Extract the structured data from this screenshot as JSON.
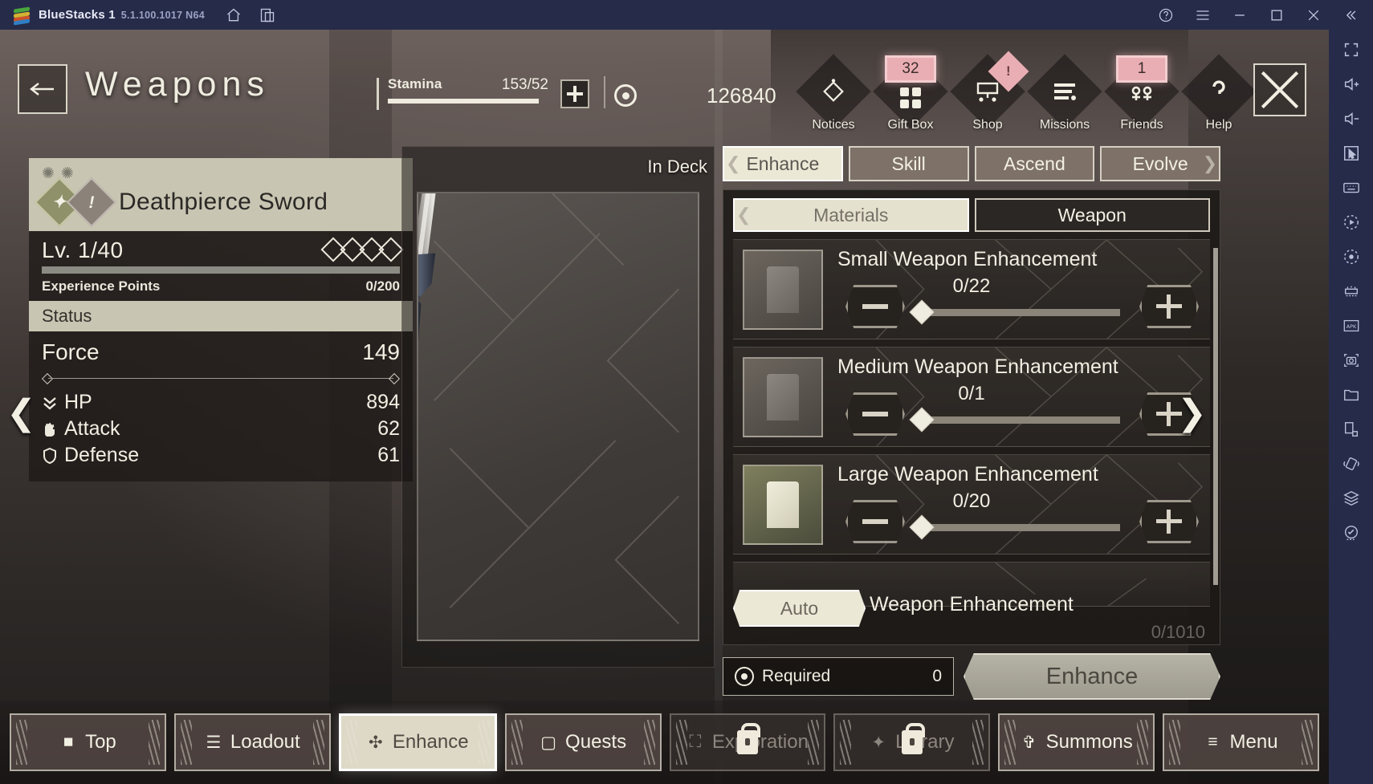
{
  "titlebar": {
    "app_name": "BlueStacks 1",
    "version": "5.1.100.1017 N64",
    "icons_left": [
      "home-icon",
      "multi-instance-icon"
    ],
    "icons_right": [
      "help-icon",
      "hamburger-menu-icon",
      "minimize-icon",
      "maximize-icon",
      "close-icon",
      "collapse-icon"
    ]
  },
  "game": {
    "header": {
      "back_label": "back-arrow",
      "title": "Weapons",
      "stamina_label": "Stamina",
      "stamina_value": "153/52",
      "stamina_plus": "+",
      "currency_value": "126840",
      "menu": [
        {
          "label": "Notices",
          "icon": "diamond-notice-icon",
          "badge": ""
        },
        {
          "label": "Gift Box",
          "icon": "gift-grid-icon",
          "badge": "32"
        },
        {
          "label": "Shop",
          "icon": "shop-cart-icon",
          "badge": "",
          "corner_badge": "!"
        },
        {
          "label": "Missions",
          "icon": "missions-list-icon",
          "badge": ""
        },
        {
          "label": "Friends",
          "icon": "friends-icon",
          "badge": "1"
        },
        {
          "label": "Help",
          "icon": "question-mark-icon",
          "badge": ""
        }
      ],
      "close_label": "close-screen"
    },
    "weapon_card": {
      "rarity_stars": [
        "star",
        "star"
      ],
      "icon_element": "element-diamond-icon",
      "icon_alert": "alert-diamond-icon",
      "name": "Deathpierce Sword",
      "level_label": "Lv. 1/40",
      "limit_break_slots": 4,
      "xp_label": "Experience Points",
      "xp_value": "0/200",
      "status_header": "Status",
      "force_label": "Force",
      "force_value": "149",
      "stats": [
        {
          "icon": "hp-chevrons-icon",
          "label": "HP",
          "value": "894"
        },
        {
          "icon": "attack-fist-icon",
          "label": "Attack",
          "value": "62"
        },
        {
          "icon": "defense-shield-icon",
          "label": "Defense",
          "value": "61"
        }
      ]
    },
    "weapon_preview": {
      "in_deck_label": "In Deck",
      "art": "sword-illustration"
    },
    "enhance": {
      "top_tabs": [
        {
          "label": "Enhance",
          "active": true
        },
        {
          "label": "Skill",
          "active": false
        },
        {
          "label": "Ascend",
          "active": false
        },
        {
          "label": "Evolve",
          "active": false
        }
      ],
      "sub_tabs": [
        {
          "label": "Materials",
          "style": "light"
        },
        {
          "label": "Weapon",
          "style": "dark"
        }
      ],
      "rows": [
        {
          "title": "Small Weapon Enhancement",
          "count": "0/22",
          "icon": "small-material-icon",
          "minus": "minus-button",
          "plus": "plus-button"
        },
        {
          "title": "Medium Weapon Enhancement",
          "count": "0/1",
          "icon": "medium-material-icon",
          "minus": "minus-button",
          "plus": "plus-button"
        },
        {
          "title": "Large Weapon Enhancement",
          "count": "0/20",
          "icon": "large-material-icon",
          "minus": "minus-button",
          "plus": "plus-button"
        }
      ],
      "auto_button": "Auto",
      "auto_row_title": "Weapon Enhancement",
      "auto_row_count": "0/1010",
      "required_label": "Required",
      "required_value": "0",
      "enhance_button": "Enhance"
    },
    "side_arrows": {
      "left": "❮",
      "right": "❯"
    },
    "bottom_nav": [
      {
        "label": "Top",
        "icon": "top-icon",
        "state": "normal"
      },
      {
        "label": "Loadout",
        "icon": "loadout-icon",
        "state": "normal"
      },
      {
        "label": "Enhance",
        "icon": "enhance-icon",
        "state": "active"
      },
      {
        "label": "Quests",
        "icon": "quests-icon",
        "state": "normal"
      },
      {
        "label": "Exploration",
        "icon": "exploration-icon",
        "state": "locked"
      },
      {
        "label": "Library",
        "icon": "library-icon",
        "state": "locked"
      },
      {
        "label": "Summons",
        "icon": "summons-icon",
        "state": "normal"
      },
      {
        "label": "Menu",
        "icon": "menu-icon",
        "state": "normal"
      }
    ]
  },
  "sidebar": {
    "items": [
      "fullscreen-icon",
      "volume-up-icon",
      "volume-down-icon",
      "pointer-icon",
      "keyboard-icon",
      "macro-play-icon",
      "record-icon",
      "gamepad-icon",
      "apk-install-icon",
      "screenshot-icon",
      "folder-icon",
      "rotate-screen-icon",
      "shake-icon",
      "multi-instance-layers-icon",
      "location-icon"
    ]
  },
  "colors": {
    "bs_chrome": "#262b4a",
    "accent_pink": "#e9aeb3",
    "panel_cream": "#ece8d6",
    "panel_dark": "#2a2724"
  }
}
